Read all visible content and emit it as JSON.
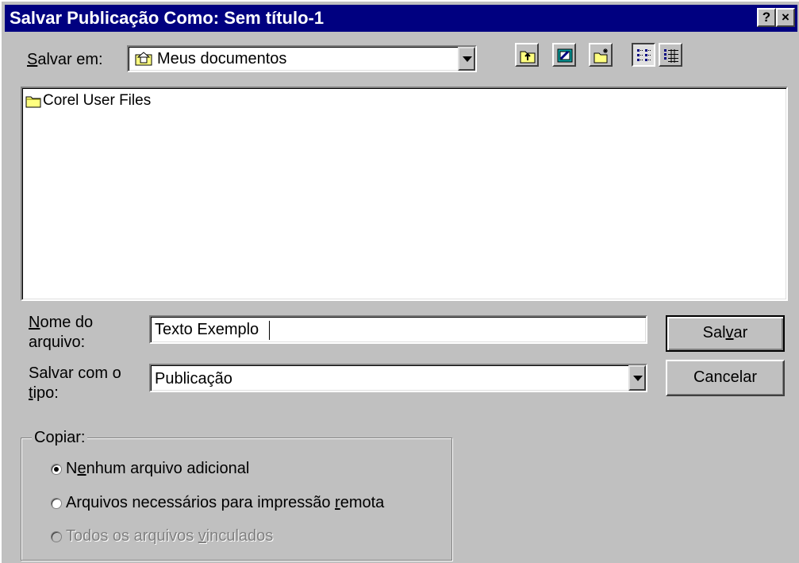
{
  "window": {
    "title": "Salvar Publicação Como: Sem título-1",
    "help_button": "?",
    "close_button": "×"
  },
  "save_in": {
    "label_prefix": "S",
    "label_rest": "alvar em:",
    "value": "Meus documentos"
  },
  "toolbar": {
    "buttons": [
      "up-one-level",
      "desktop",
      "new-folder",
      "list-view",
      "details-view"
    ]
  },
  "file_list": {
    "items": [
      {
        "name": "Corel User Files",
        "icon": "folder-icon"
      }
    ]
  },
  "filename": {
    "label_line1_u": "N",
    "label_line1_rest": "ome do",
    "label_line2": "arquivo:",
    "value": "Texto Exemplo"
  },
  "filetype": {
    "label_line1": "Salvar com o",
    "label_line2_u": "t",
    "label_line2_rest": "ipo:",
    "value": "Publicação"
  },
  "buttons": {
    "save_pre": "Sal",
    "save_u": "v",
    "save_post": "ar",
    "cancel": "Cancelar"
  },
  "copy_group": {
    "legend": "Copiar:",
    "options": [
      {
        "pre": "N",
        "u": "e",
        "post": "nhum arquivo adicional",
        "selected": true,
        "enabled": true
      },
      {
        "pre": "Arquivos necessários para impressão ",
        "u": "r",
        "post": "emota",
        "selected": false,
        "enabled": true
      },
      {
        "pre": "Todos os arquivos ",
        "u": "v",
        "post": "inculados",
        "selected": false,
        "enabled": false
      }
    ]
  }
}
